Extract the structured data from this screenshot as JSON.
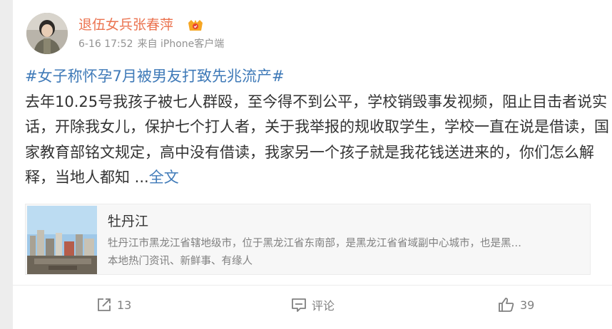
{
  "post": {
    "author": "退伍女兵张春萍",
    "time": "6-16 17:52",
    "source": "来自 iPhone客户端",
    "topic": "#女子称怀孕7月被男友打致先兆流产#",
    "body": "去年10.25号我孩子被七人群殴，至今得不到公平，学校销毁事发视频，阻止目击者说实话，开除我女儿，保护七个打人者，关于我举报的规收取学生，学校一直在说是借读，国家教育部铭文规定，高中没有借读，我家另一个孩子就是我花钱送进来的，你们怎么解释，当地人都知",
    "ellipsis": " ...",
    "full_text_link": "全文"
  },
  "location": {
    "title": "牡丹江",
    "description": "牡丹江市黑龙江省辖地级市，位于黑龙江省东南部，是黑龙江省省域副中心城市，也是黑…",
    "tags": "本地热门资讯、新鲜事、有缘人"
  },
  "actions": {
    "repost_count": "13",
    "comment_label": "评论",
    "like_count": "39"
  },
  "colors": {
    "author": "#eb7350",
    "link": "#3f7ab8",
    "text": "#333333",
    "muted": "#939393"
  }
}
